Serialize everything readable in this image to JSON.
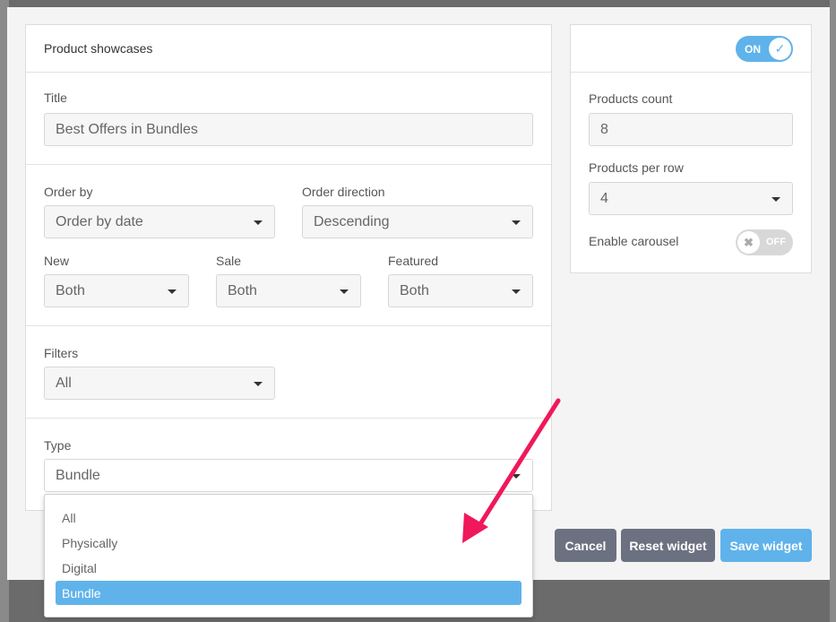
{
  "colors": {
    "accent": "#5fb3ea",
    "button_dark": "#6c7181",
    "arrow": "#f0185a"
  },
  "showcase": {
    "header": "Product showcases",
    "title_label": "Title",
    "title_value": "Best Offers in Bundles",
    "order_by_label": "Order by",
    "order_by_value": "Order by date",
    "order_dir_label": "Order direction",
    "order_dir_value": "Descending",
    "new_label": "New",
    "new_value": "Both",
    "sale_label": "Sale",
    "sale_value": "Both",
    "featured_label": "Featured",
    "featured_value": "Both",
    "filters_label": "Filters",
    "filters_value": "All",
    "type_label": "Type",
    "type_value": "Bundle"
  },
  "settings": {
    "toggle_on_label": "ON",
    "products_count_label": "Products count",
    "products_count_value": "8",
    "per_row_label": "Products per row",
    "per_row_value": "4",
    "carousel_label": "Enable carousel",
    "carousel_toggle_label": "OFF"
  },
  "type_options": [
    "All",
    "Physically",
    "Digital",
    "Bundle"
  ],
  "type_selected": "Bundle",
  "buttons": {
    "cancel": "Cancel",
    "reset": "Reset widget",
    "save": "Save widget"
  },
  "icons": {
    "dropdown": "caret-down-icon",
    "on": "check-icon",
    "off": "x-icon",
    "annotation": "arrow-icon"
  }
}
